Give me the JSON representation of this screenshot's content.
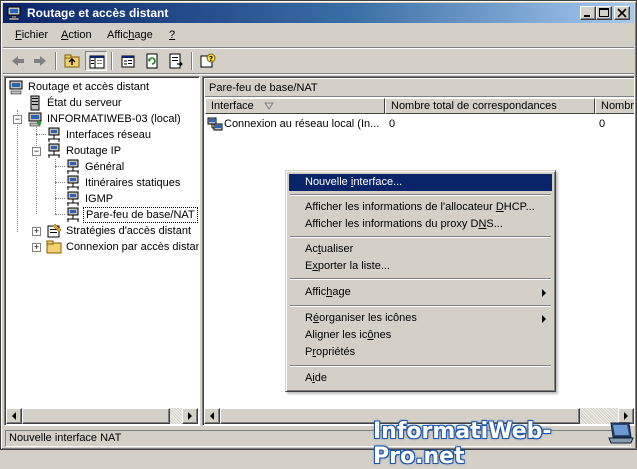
{
  "window": {
    "title": "Routage et accès distant"
  },
  "menubar": {
    "items": [
      {
        "pre": "",
        "key": "F",
        "post": "ichier"
      },
      {
        "pre": "",
        "key": "A",
        "post": "ction"
      },
      {
        "pre": "Affic",
        "key": "h",
        "post": "age"
      },
      {
        "pre": "",
        "key": "?",
        "post": ""
      }
    ]
  },
  "tree": {
    "items": [
      {
        "label": "Routage et accès distant"
      },
      {
        "label": "État du serveur"
      },
      {
        "label": "INFORMATIWEB-03 (local)"
      },
      {
        "label": "Interfaces réseau"
      },
      {
        "label": "Routage IP"
      },
      {
        "label": "Général"
      },
      {
        "label": "Itinéraires statiques"
      },
      {
        "label": "IGMP"
      },
      {
        "label": "Pare-feu de base/NAT"
      },
      {
        "label": "Stratégies d'accès distant"
      },
      {
        "label": "Connexion par accès distant"
      }
    ]
  },
  "right_pane": {
    "header": "Pare-feu de base/NAT",
    "columns": [
      "Interface",
      "Nombre total de correspondances",
      "Nombre"
    ],
    "rows": [
      {
        "interface": "Connexion au réseau local (In...",
        "total": "0",
        "nombre": "0"
      }
    ]
  },
  "context_menu": {
    "items": [
      {
        "pre": "Nouvelle ",
        "key": "i",
        "post": "nterface..."
      },
      {
        "pre": "Afficher les informations de l'allocateur ",
        "key": "D",
        "post": "HCP..."
      },
      {
        "pre": "Afficher les informations du proxy D",
        "key": "N",
        "post": "S..."
      },
      {
        "pre": "Ac",
        "key": "t",
        "post": "ualiser"
      },
      {
        "pre": "E",
        "key": "x",
        "post": "porter la liste..."
      },
      {
        "pre": "Affic",
        "key": "h",
        "post": "age"
      },
      {
        "pre": "R",
        "key": "é",
        "post": "organiser les icônes"
      },
      {
        "pre": "Aligner les ic",
        "key": "ô",
        "post": "nes"
      },
      {
        "pre": "P",
        "key": "r",
        "post": "opriétés"
      },
      {
        "pre": "A",
        "key": "i",
        "post": "de"
      }
    ]
  },
  "status_bar": {
    "text": "Nouvelle interface NAT"
  },
  "watermark": {
    "text": "InformatiWeb-Pro.net"
  }
}
